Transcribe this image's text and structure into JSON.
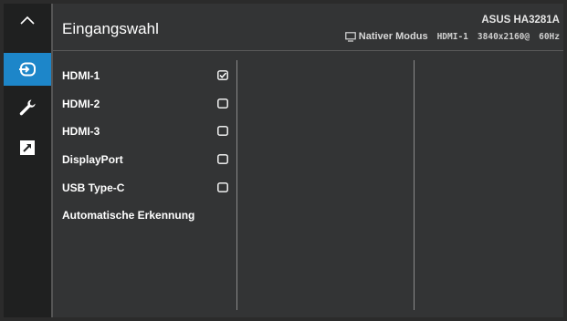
{
  "header": {
    "title": "Eingangswahl",
    "model": "ASUS HA3281A",
    "mode_label": "Nativer Modus",
    "input": "HDMI-1",
    "resolution": "3840x2160@",
    "refresh": "60Hz"
  },
  "sidebar": {
    "items": [
      {
        "name": "up-arrow-icon"
      },
      {
        "name": "input-icon",
        "active": true
      },
      {
        "name": "wrench-icon"
      },
      {
        "name": "shortcut-icon"
      }
    ]
  },
  "menu": {
    "items": [
      {
        "label": "HDMI-1",
        "checked": true
      },
      {
        "label": "HDMI-2",
        "checked": false
      },
      {
        "label": "HDMI-3",
        "checked": false
      },
      {
        "label": "DisplayPort",
        "checked": false
      },
      {
        "label": "USB Type-C",
        "checked": false
      },
      {
        "label": "Automatische Erkennung",
        "checked": false,
        "no_box": true
      }
    ]
  },
  "colors": {
    "accent": "#1d86c9",
    "background": "#333435",
    "sidebar": "#1f2020"
  }
}
